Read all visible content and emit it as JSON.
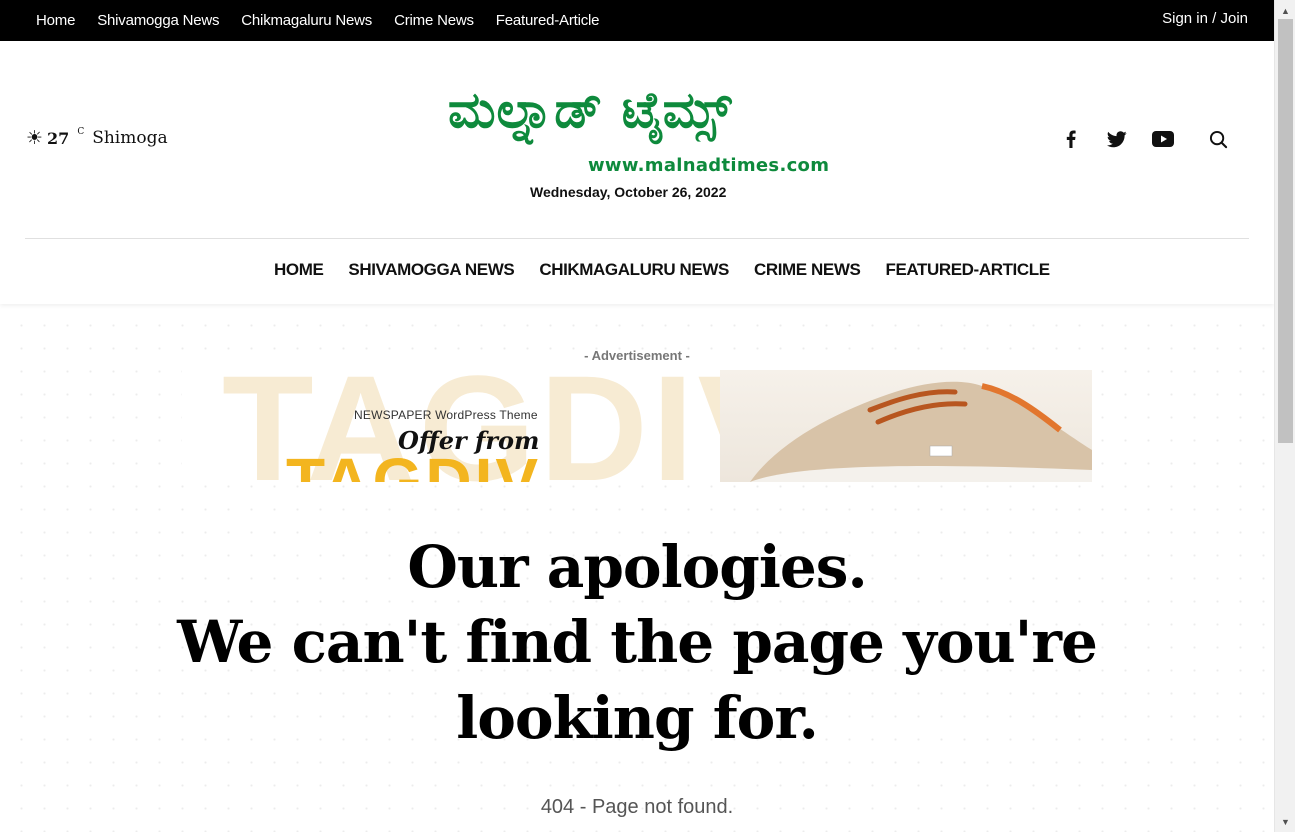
{
  "topbar": {
    "links": [
      "Home",
      "Shivamogga News",
      "Chikmagaluru News",
      "Crime News",
      "Featured-Article"
    ],
    "signin": "Sign in / Join"
  },
  "weather": {
    "icon": "sun-icon",
    "temp": "27",
    "unit": "C",
    "city": "Shimoga"
  },
  "logo": {
    "title": "ಮಲ್ನಾಡ್ ಟೈಮ್ಸ್",
    "url": "www.malnadtimes.com",
    "color": "#0e8a3c"
  },
  "date": "Wednesday, October 26, 2022",
  "social": [
    "facebook-icon",
    "twitter-icon",
    "youtube-icon",
    "search-icon"
  ],
  "mainnav": [
    "HOME",
    "SHIVAMOGGA NEWS",
    "CHIKMAGALURU NEWS",
    "CRIME NEWS",
    "FEATURED-ARTICLE"
  ],
  "ad": {
    "label": "- Advertisement -",
    "bg_text": "TAGDIV",
    "sub": "NEWSPAPER WordPress Theme",
    "offer": "Offer from",
    "brand": "TAGDIV",
    "brand_color": "#f3b51f"
  },
  "error": {
    "line1": "Our apologies.",
    "line2": "We can't find the page you're looking for.",
    "status": "404 - Page not found."
  }
}
